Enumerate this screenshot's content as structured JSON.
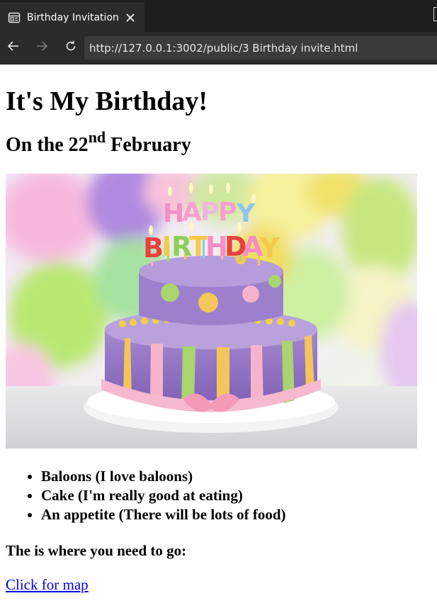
{
  "browser": {
    "tab_title": "Birthday Invitation",
    "url": "http://127.0.0.1:3002/public/3 Birthday invite.html"
  },
  "page": {
    "heading": "It's My Birthday!",
    "date_prefix": "On the 22",
    "date_suffix_sup": "nd",
    "date_month": " February",
    "image_lettering": "HAPPY BIRTHDAY",
    "list_items": [
      "Baloons (I love baloons)",
      "Cake (I'm really good at eating)",
      "An appetite (There will be lots of food)"
    ],
    "directions_text": "The is where you need to go:",
    "map_link_text": "Click for map"
  },
  "colors": {
    "chrome_dark": "#1e1e1e",
    "chrome_tab": "#2b2b2b",
    "address_bar": "#3b3b3b",
    "link": "#0000ee"
  }
}
